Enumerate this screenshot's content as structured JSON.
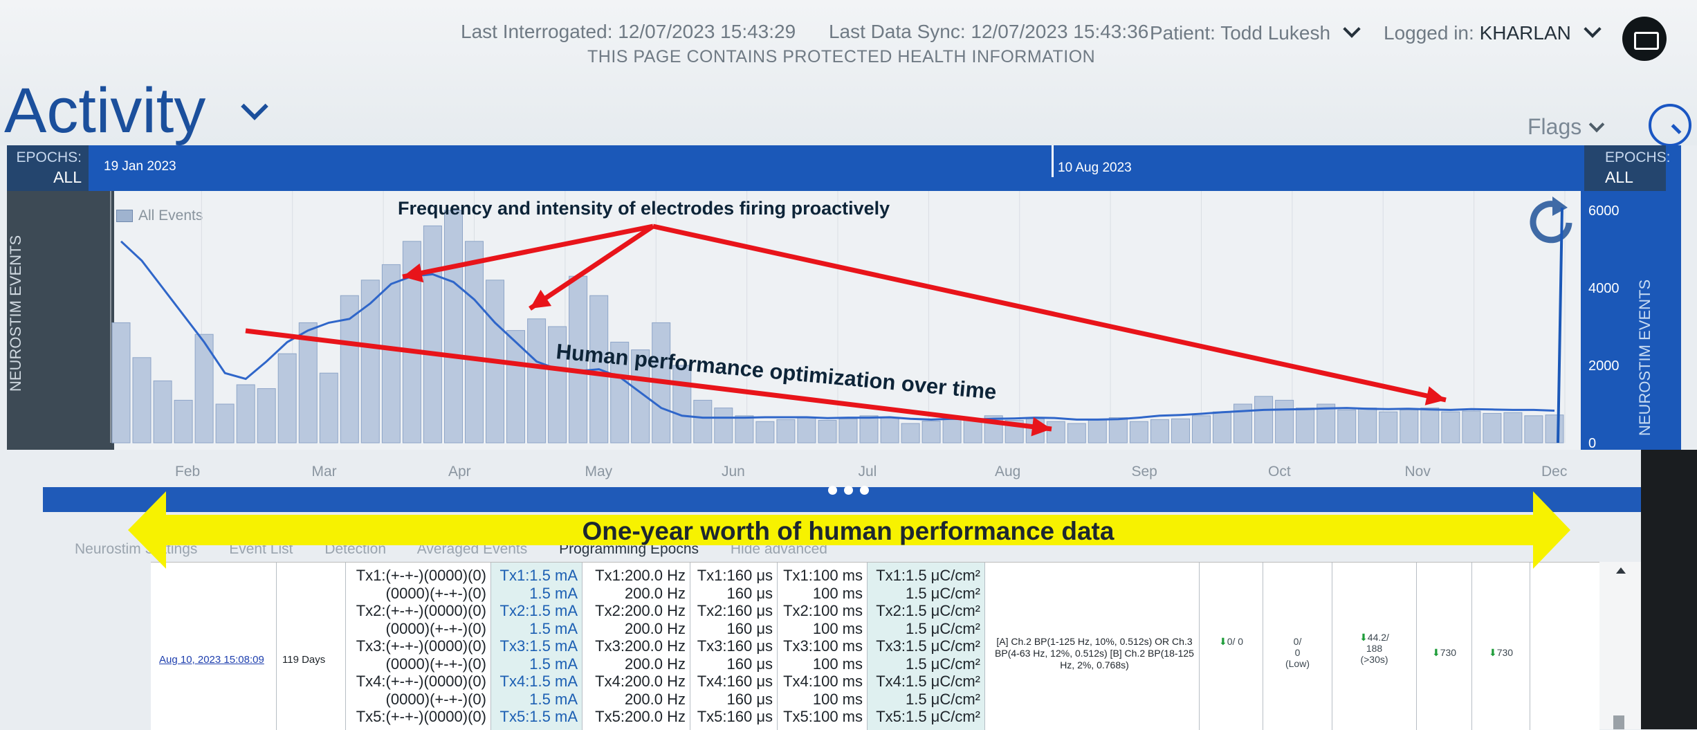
{
  "header": {
    "last_interrogated": "Last Interrogated: 12/07/2023 15:43:29",
    "last_sync": "Last Data Sync: 12/07/2023 15:43:36",
    "phi_notice": "THIS PAGE CONTAINS PROTECTED HEALTH INFORMATION",
    "patient": "Patient: Todd Lukesh",
    "logged_in_label": "Logged in:",
    "logged_in_user": "KHARLAN"
  },
  "page": {
    "title": "Activity",
    "flags_label": "Flags"
  },
  "timeline": {
    "epochs_label": "EPOCHS:",
    "epochs_value": "ALL",
    "epochs_label_right": "EPOCHS:",
    "epochs_value_right": "ALL",
    "start_date": "19 Jan 2023",
    "marker_date": "10 Aug 2023"
  },
  "chart_data": {
    "type": "bar",
    "legend": "All Events",
    "ylabel_left": "NEUROSTIM EVENTS",
    "ylabel_right": "NEUROSTIM EVENTS",
    "yticks": [
      "0",
      "2000",
      "4000",
      "6000"
    ],
    "ylim": [
      0,
      6500
    ],
    "months": [
      "Feb",
      "Mar",
      "Apr",
      "May",
      "Jun",
      "Jul",
      "Aug",
      "Sep",
      "Oct",
      "Nov",
      "Dec"
    ],
    "weekly_totals": [
      3100,
      2200,
      1600,
      1100,
      2800,
      1000,
      1500,
      1400,
      2300,
      3100,
      1800,
      3800,
      4200,
      4600,
      5200,
      5600,
      6000,
      5200,
      4200,
      2900,
      3200,
      3000,
      4300,
      3800,
      2600,
      2400,
      3100,
      2000,
      1100,
      900,
      700,
      550,
      600,
      650,
      580,
      620,
      700,
      650,
      500,
      560,
      640,
      600,
      700,
      580,
      620,
      550,
      500,
      600,
      650,
      550,
      600,
      620,
      700,
      800,
      1000,
      1200,
      1100,
      900,
      1000,
      850,
      900,
      800,
      850,
      900,
      800,
      820,
      760,
      780,
      700,
      720
    ],
    "trend": [
      5200,
      4700,
      4000,
      3300,
      2600,
      1800,
      1650,
      2100,
      2600,
      2900,
      3100,
      3200,
      3600,
      4100,
      4300,
      4350,
      4150,
      3700,
      3100,
      2600,
      2100,
      1900,
      1850,
      1900,
      1700,
      1300,
      900,
      700,
      650,
      650,
      650,
      660,
      660,
      660,
      640,
      650,
      650,
      660,
      620,
      600,
      620,
      600,
      620,
      630,
      650,
      640,
      600,
      600,
      610,
      650,
      700,
      720,
      750,
      790,
      820,
      850,
      860,
      870,
      890,
      900,
      880,
      870,
      880,
      860,
      850,
      870,
      860,
      850,
      850,
      830
    ]
  },
  "annotations": {
    "top_caption": "Frequency and intensity of electrodes firing proactively",
    "middle_caption": "Human performance optimization over time",
    "banner": "One-year worth of human performance data"
  },
  "tabs": [
    "Neurostim Settings",
    "Event List",
    "Detection",
    "Averaged Events",
    "Programming Epochs",
    "Hide advanced"
  ],
  "table": {
    "date": "Aug 10, 2023 15:08:09",
    "days": "119 Days",
    "montage": [
      "Tx1:(+-+-)(0000)(0)",
      "(0000)(+-+-)(0)",
      "Tx2:(+-+-)(0000)(0)",
      "(0000)(+-+-)(0)",
      "Tx3:(+-+-)(0000)(0)",
      "(0000)(+-+-)(0)",
      "Tx4:(+-+-)(0000)(0)",
      "(0000)(+-+-)(0)",
      "Tx5:(+-+-)(0000)(0)"
    ],
    "current": [
      "Tx1:1.5 mA",
      "1.5 mA",
      "Tx2:1.5 mA",
      "1.5 mA",
      "Tx3:1.5 mA",
      "1.5 mA",
      "Tx4:1.5 mA",
      "1.5 mA",
      "Tx5:1.5 mA"
    ],
    "frequency": [
      "Tx1:200.0 Hz",
      "200.0 Hz",
      "Tx2:200.0 Hz",
      "200.0 Hz",
      "Tx3:200.0 Hz",
      "200.0 Hz",
      "Tx4:200.0 Hz",
      "200.0 Hz",
      "Tx5:200.0 Hz"
    ],
    "pulse_width": [
      "Tx1:160 μs",
      "160 μs",
      "Tx2:160 μs",
      "160 μs",
      "Tx3:160 μs",
      "160 μs",
      "Tx4:160 μs",
      "160 μs",
      "Tx5:160 μs"
    ],
    "burst": [
      "Tx1:100 ms",
      "100 ms",
      "Tx2:100 ms",
      "100 ms",
      "Tx3:100 ms",
      "100 ms",
      "Tx4:100 ms",
      "100 ms",
      "Tx5:100 ms"
    ],
    "charge": [
      "Tx1:1.5 μC/cm²",
      "1.5 μC/cm²",
      "Tx2:1.5 μC/cm²",
      "1.5 μC/cm²",
      "Tx3:1.5 μC/cm²",
      "1.5 μC/cm²",
      "Tx4:1.5 μC/cm²",
      "1.5 μC/cm²",
      "Tx5:1.5 μC/cm²"
    ],
    "detection": "[A] Ch.2 BP(1-125 Hz, 10%, 0.512s) OR Ch.3 BP(4-63 Hz, 12%, 0.512s) [B] Ch.2 BP(18-125 Hz, 2%, 0.768s)",
    "c1": "0/ 0",
    "c2a": "0/",
    "c2b": "0",
    "c2c": "(Low)",
    "c3a": "44.2/",
    "c3b": "188",
    "c3c": "(>30s)",
    "c4": "730",
    "c5": "730"
  },
  "colors": {
    "brand_blue": "#1b58b8",
    "annotation_red": "#e8141a",
    "banner_yellow": "#f7f200"
  }
}
